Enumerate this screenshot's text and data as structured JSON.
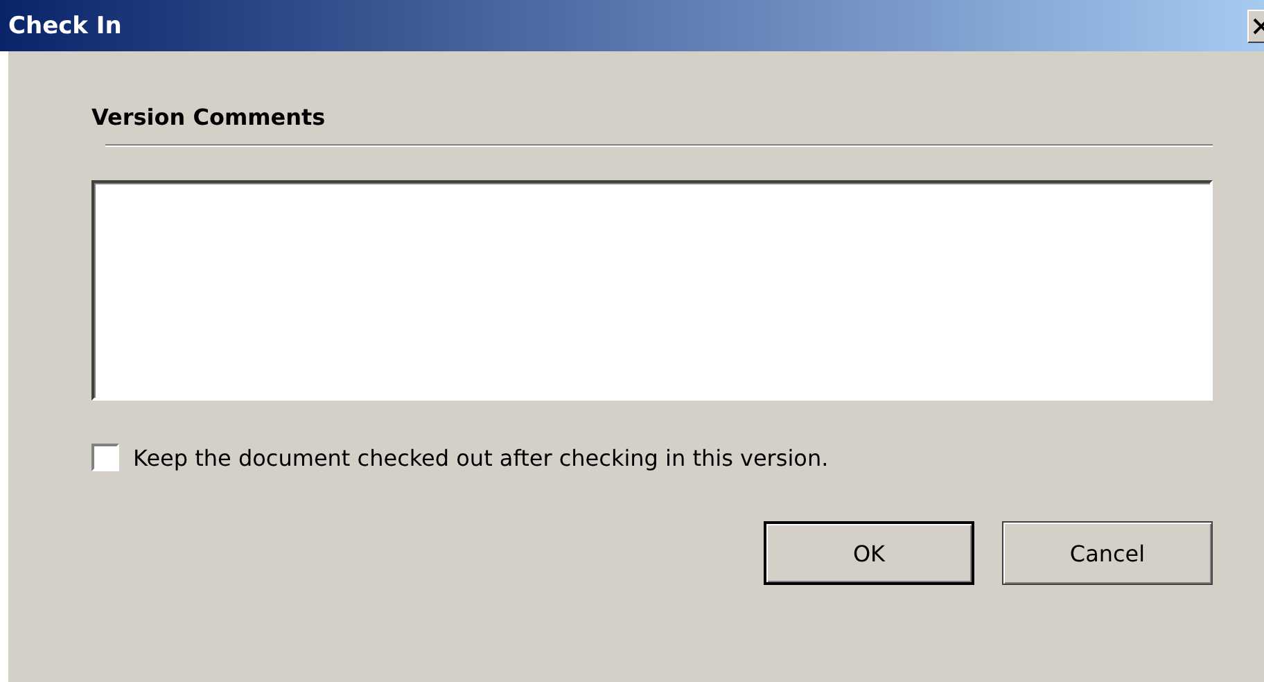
{
  "window": {
    "title": "Check In"
  },
  "comments": {
    "heading": "Version Comments"
  },
  "keep_checked_out": {
    "label": "Keep the document checked out after checking in this version.",
    "checked": false
  },
  "buttons": [
    {
      "label": "OK",
      "default": true
    },
    {
      "label": "Cancel",
      "default": false
    }
  ]
}
